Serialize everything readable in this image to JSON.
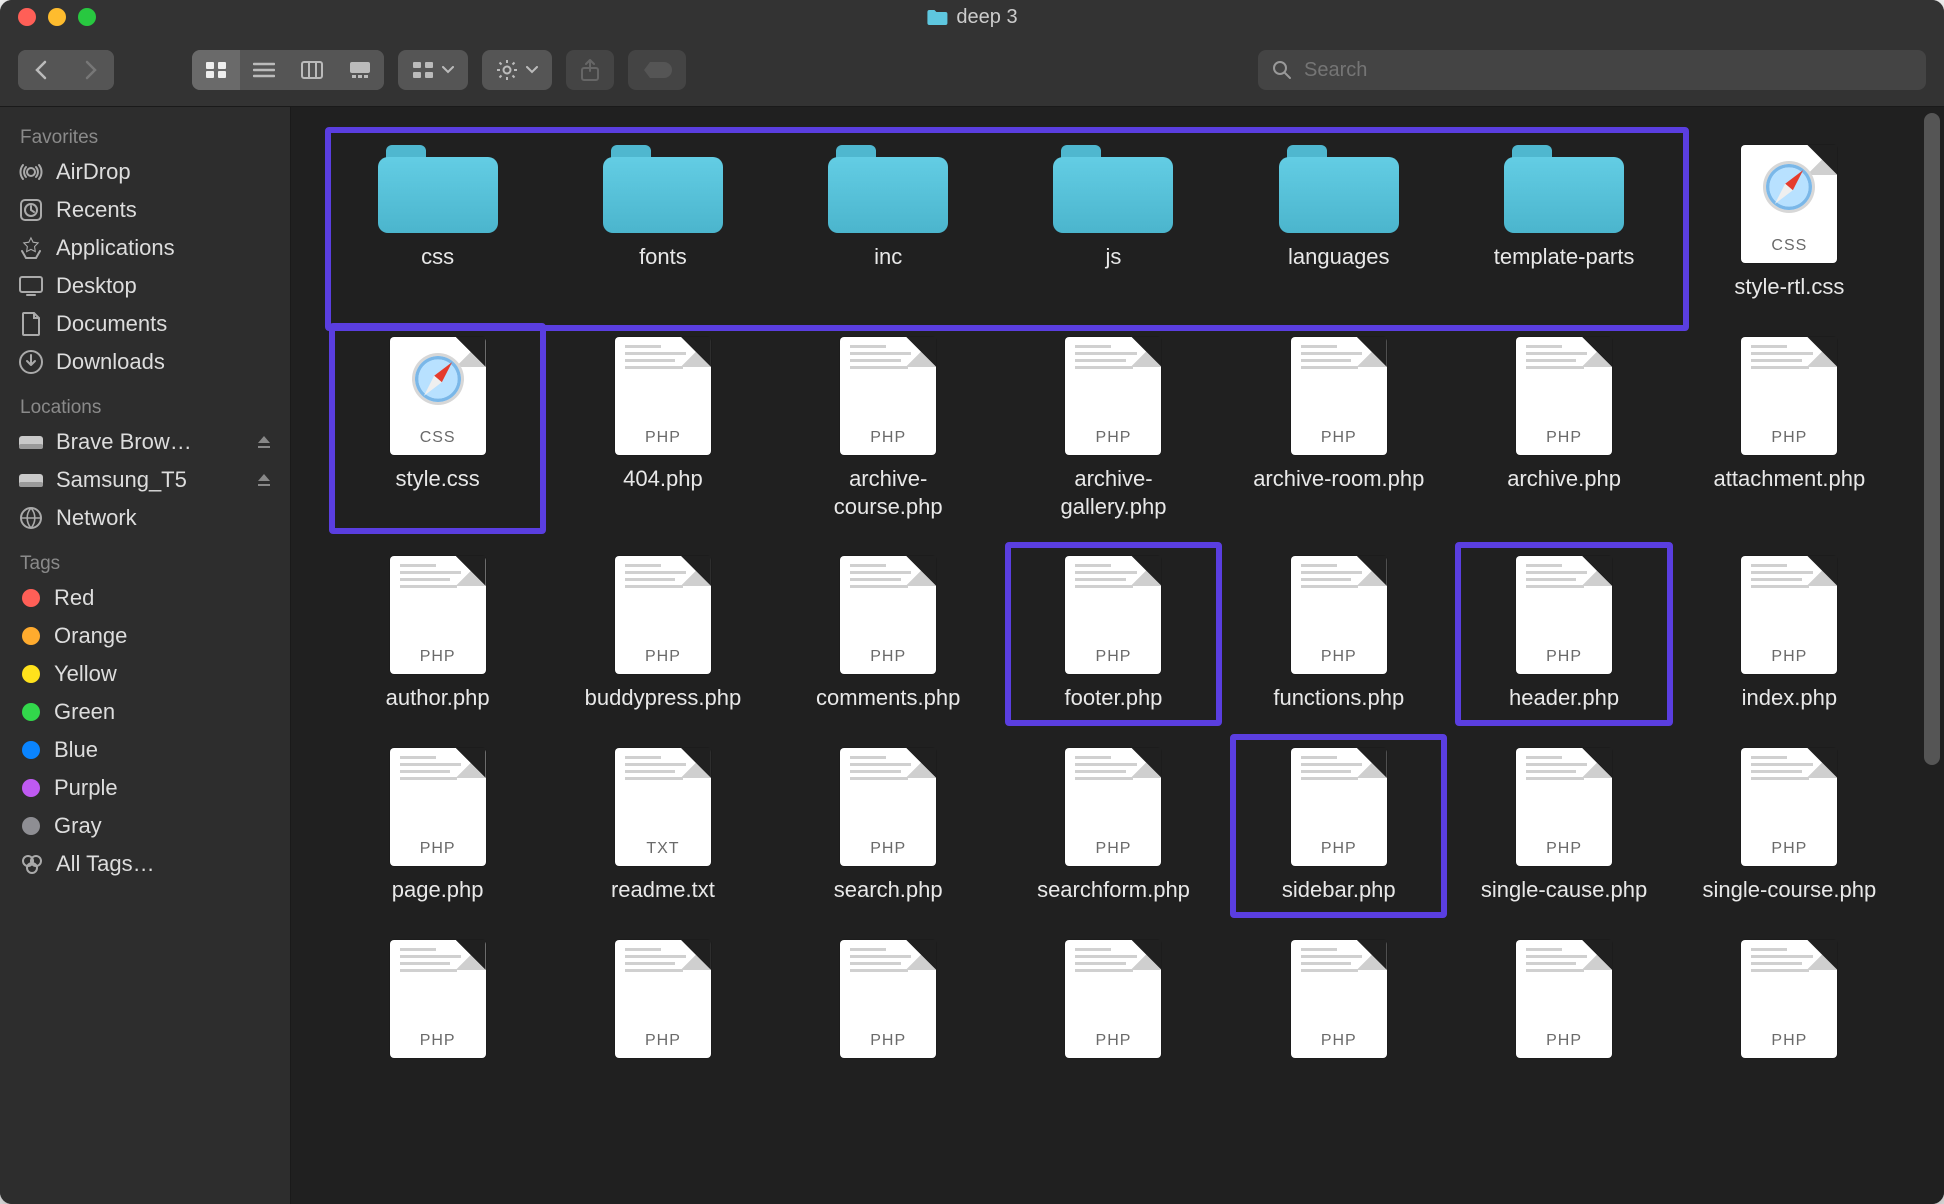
{
  "window": {
    "title": "deep 3"
  },
  "toolbar": {
    "search_placeholder": "Search"
  },
  "sidebar": {
    "sections": {
      "favorites": {
        "title": "Favorites",
        "items": [
          "AirDrop",
          "Recents",
          "Applications",
          "Desktop",
          "Documents",
          "Downloads"
        ]
      },
      "locations": {
        "title": "Locations",
        "items": [
          "Brave Brow…",
          "Samsung_T5",
          "Network"
        ]
      },
      "tags": {
        "title": "Tags",
        "items": [
          {
            "label": "Red",
            "color": "#ff5f57"
          },
          {
            "label": "Orange",
            "color": "#ffab2e"
          },
          {
            "label": "Yellow",
            "color": "#ffe21c"
          },
          {
            "label": "Green",
            "color": "#32d74b"
          },
          {
            "label": "Blue",
            "color": "#0a84ff"
          },
          {
            "label": "Purple",
            "color": "#bf5af2"
          },
          {
            "label": "Gray",
            "color": "#8e8e93"
          }
        ],
        "all_label": "All Tags…"
      }
    }
  },
  "files": [
    {
      "name": "css",
      "kind": "folder",
      "hl": "group"
    },
    {
      "name": "fonts",
      "kind": "folder",
      "hl": "group"
    },
    {
      "name": "inc",
      "kind": "folder",
      "hl": "group"
    },
    {
      "name": "js",
      "kind": "folder",
      "hl": "group"
    },
    {
      "name": "languages",
      "kind": "folder",
      "hl": "group"
    },
    {
      "name": "template-parts",
      "kind": "folder",
      "hl": "group"
    },
    {
      "name": "style-rtl.css",
      "kind": "css"
    },
    {
      "name": "style.css",
      "kind": "css",
      "hl": "single"
    },
    {
      "name": "404.php",
      "kind": "php"
    },
    {
      "name": "archive-\ncourse.php",
      "kind": "php"
    },
    {
      "name": "archive-\ngallery.php",
      "kind": "php"
    },
    {
      "name": "archive-room.php",
      "kind": "php"
    },
    {
      "name": "archive.php",
      "kind": "php"
    },
    {
      "name": "attachment.php",
      "kind": "php"
    },
    {
      "name": "author.php",
      "kind": "php"
    },
    {
      "name": "buddypress.php",
      "kind": "php"
    },
    {
      "name": "comments.php",
      "kind": "php"
    },
    {
      "name": "footer.php",
      "kind": "php",
      "hl": "single"
    },
    {
      "name": "functions.php",
      "kind": "php"
    },
    {
      "name": "header.php",
      "kind": "php",
      "hl": "single"
    },
    {
      "name": "index.php",
      "kind": "php"
    },
    {
      "name": "page.php",
      "kind": "php"
    },
    {
      "name": "readme.txt",
      "kind": "txt"
    },
    {
      "name": "search.php",
      "kind": "php"
    },
    {
      "name": "searchform.php",
      "kind": "php"
    },
    {
      "name": "sidebar.php",
      "kind": "php",
      "hl": "single"
    },
    {
      "name": "single-cause.php",
      "kind": "php"
    },
    {
      "name": "single-course.php",
      "kind": "php"
    },
    {
      "name": "",
      "kind": "php"
    },
    {
      "name": "",
      "kind": "php"
    },
    {
      "name": "",
      "kind": "php"
    },
    {
      "name": "",
      "kind": "php"
    },
    {
      "name": "",
      "kind": "php"
    },
    {
      "name": "",
      "kind": "php"
    },
    {
      "name": "",
      "kind": "php"
    }
  ]
}
